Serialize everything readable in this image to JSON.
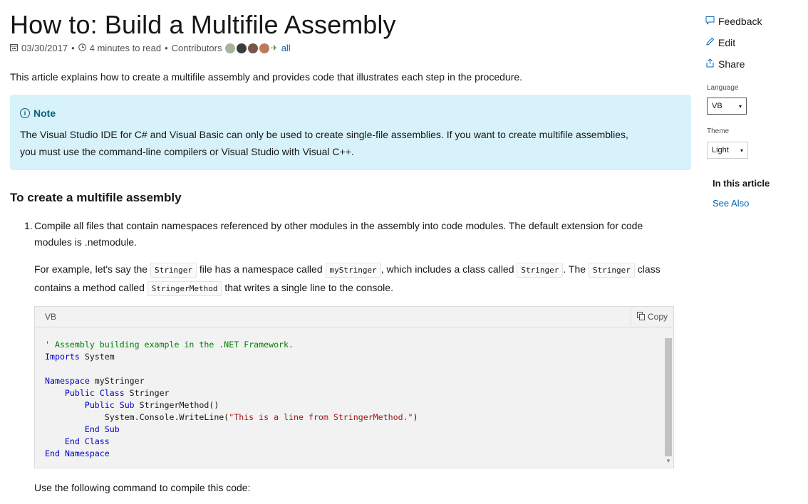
{
  "title": "How to: Build a Multifile Assembly",
  "meta": {
    "date": "03/30/2017",
    "read_time": "4 minutes to read",
    "contributors_label": "Contributors",
    "all_link": "all"
  },
  "intro": "This article explains how to create a multifile assembly and provides code that illustrates each step in the procedure.",
  "note": {
    "heading": "Note",
    "body": "The Visual Studio IDE for C# and Visual Basic can only be used to create single-file assemblies. If you want to create multifile assemblies, you must use the command-line compilers or Visual Studio with Visual C++."
  },
  "section_heading": "To create a multifile assembly",
  "step1": {
    "number": "1.",
    "text": "Compile all files that contain namespaces referenced by other modules in the assembly into code modules. The default extension for code modules is .netmodule.",
    "example": {
      "t1": "For example, let's say the ",
      "c1": "Stringer",
      "t2": " file has a namespace called ",
      "c2": "myStringer",
      "t3": ", which includes a class called ",
      "c3": "Stringer",
      "t4": ". The ",
      "c4": "Stringer",
      "t5": " class contains a method called ",
      "c5": "StringerMethod",
      "t6": " that writes a single line to the console."
    }
  },
  "codeblock": {
    "language": "VB",
    "copy_label": "Copy"
  },
  "after_code": "Use the following command to compile this code:",
  "sidebar": {
    "feedback": "Feedback",
    "edit": "Edit",
    "share": "Share",
    "language_label": "Language",
    "language_value": "VB",
    "theme_label": "Theme",
    "theme_value": "Light",
    "toc_title": "In this article",
    "toc_link": "See Also"
  }
}
